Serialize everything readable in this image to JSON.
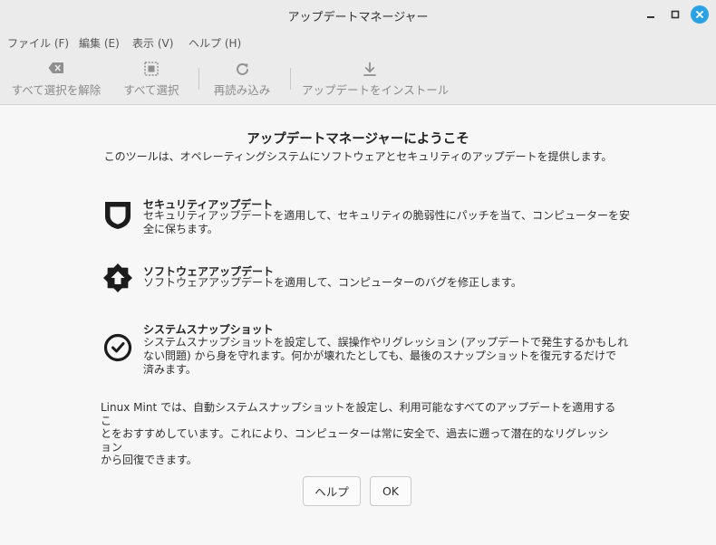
{
  "window": {
    "title": "アップデートマネージャー",
    "controls": {
      "minimize": "minimize-icon",
      "maximize": "maximize-icon",
      "close": "close-icon"
    }
  },
  "menubar": [
    {
      "label": "ファイル (F)"
    },
    {
      "label": "編集 (E)"
    },
    {
      "label": "表示 (V)"
    },
    {
      "label": "ヘルプ (H)"
    }
  ],
  "toolbar": {
    "clear_selection": {
      "label": "すべて選択を解除",
      "icon": "backspace-icon"
    },
    "select_all": {
      "label": "すべて選択",
      "icon": "select-all-icon"
    },
    "refresh": {
      "label": "再読み込み",
      "icon": "refresh-icon"
    },
    "install": {
      "label": "アップデートをインストール",
      "icon": "download-icon"
    }
  },
  "welcome": {
    "title": "アップデートマネージャーにようこそ",
    "subtitle": "このツールは、オペレーティングシステムにソフトウェアとセキュリティのアップデートを提供します。",
    "features": [
      {
        "title": "セキュリティアップデート",
        "icon": "shield-icon",
        "lines": [
          "セキュリティアップデートを適用して、セキュリティの脆弱性にパッチを当て、コンピューターを安",
          "全に保ちます。"
        ]
      },
      {
        "title": "ソフトウェアアップデート",
        "icon": "badge-up-icon",
        "lines": [
          "ソフトウェアアップデートを適用して、コンピューターのバグを修正します。"
        ]
      },
      {
        "title": "システムスナップショット",
        "icon": "clock-icon",
        "lines": [
          "システムスナップショットを設定して、誤操作やリグレッション (アップデートで発生するかもしれ",
          "ない問題) から身を守れます。何かが壊れたとしても、最後のスナップショットを復元するだけで",
          "済みます。"
        ]
      }
    ],
    "footer_lines": [
      "Linux Mint では、自動システムスナップショットを設定し、利用可能なすべてのアップデートを適用するこ",
      "とをおすすめしています。これにより、コンピューターは常に安全で、過去に遡って潜在的なリグレッション",
      "から回復できます。"
    ]
  },
  "buttons": {
    "help": "ヘルプ",
    "ok": "OK"
  }
}
